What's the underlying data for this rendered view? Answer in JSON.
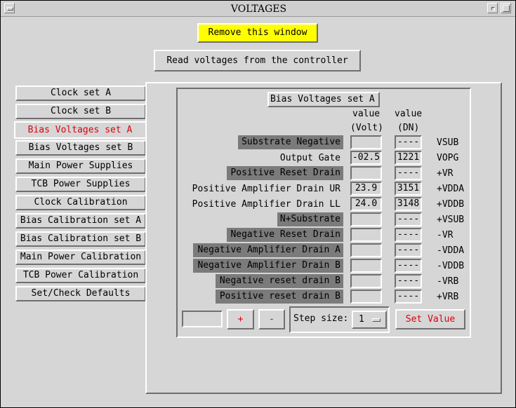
{
  "window": {
    "title": "VOLTAGES"
  },
  "actions": {
    "remove_label": "Remove this window",
    "read_label": "Read voltages from the controller"
  },
  "tabs": [
    "Clock set A",
    "Clock set B",
    "Bias Voltages set A",
    "Bias Voltages set B",
    "Main Power Supplies",
    "TCB Power Supplies",
    "Clock Calibration",
    "Bias Calibration set A",
    "Bias Calibration set B",
    "Main Power Calibration",
    "TCB Power Calibration",
    "Set/Check Defaults"
  ],
  "active_tab": "Bias Voltages set A",
  "panel": {
    "title": "Bias Voltages set A",
    "col_value_1": "value",
    "col_value_2": "(Volt)",
    "col_dn_1": "value",
    "col_dn_2": "(DN)",
    "rows": [
      {
        "name": "Substrate Negative",
        "volt": "",
        "dn": "----",
        "signal": "VSUB"
      },
      {
        "name": "Output Gate",
        "volt": "-02.5",
        "dn": "1221",
        "signal": "VOPG"
      },
      {
        "name": "Positive Reset Drain",
        "volt": "",
        "dn": "----",
        "signal": "+VR"
      },
      {
        "name": "Positive Amplifier Drain UR",
        "volt": "23.9",
        "dn": "3151",
        "signal": "+VDDA"
      },
      {
        "name": "Positive Amplifier Drain LL",
        "volt": "24.0",
        "dn": "3148",
        "signal": "+VDDB"
      },
      {
        "name": "N+Substrate",
        "volt": "",
        "dn": "----",
        "signal": "+VSUB"
      },
      {
        "name": "Negative Reset Drain",
        "volt": "",
        "dn": "----",
        "signal": "-VR"
      },
      {
        "name": "Negative Amplifier Drain A",
        "volt": "",
        "dn": "----",
        "signal": "-VDDA"
      },
      {
        "name": "Negative Amplifier Drain B",
        "volt": "",
        "dn": "----",
        "signal": "-VDDB"
      },
      {
        "name": "Negative reset drain B",
        "volt": "",
        "dn": "----",
        "signal": "-VRB"
      },
      {
        "name": "Positive reset drain B",
        "volt": "",
        "dn": "----",
        "signal": "+VRB"
      }
    ]
  },
  "controls": {
    "entry_value": "",
    "plus_label": "+",
    "minus_label": "-",
    "step_label": "Step size:",
    "step_value": "1",
    "set_value_label": "Set Value"
  },
  "colors": {
    "remove_button_bg": "#ffff00",
    "active_tab_text": "#e0000a",
    "action_text_red": "#e0000a",
    "dark_label_bg": "#7b7b7b",
    "window_bg": "#d6d6d6"
  }
}
